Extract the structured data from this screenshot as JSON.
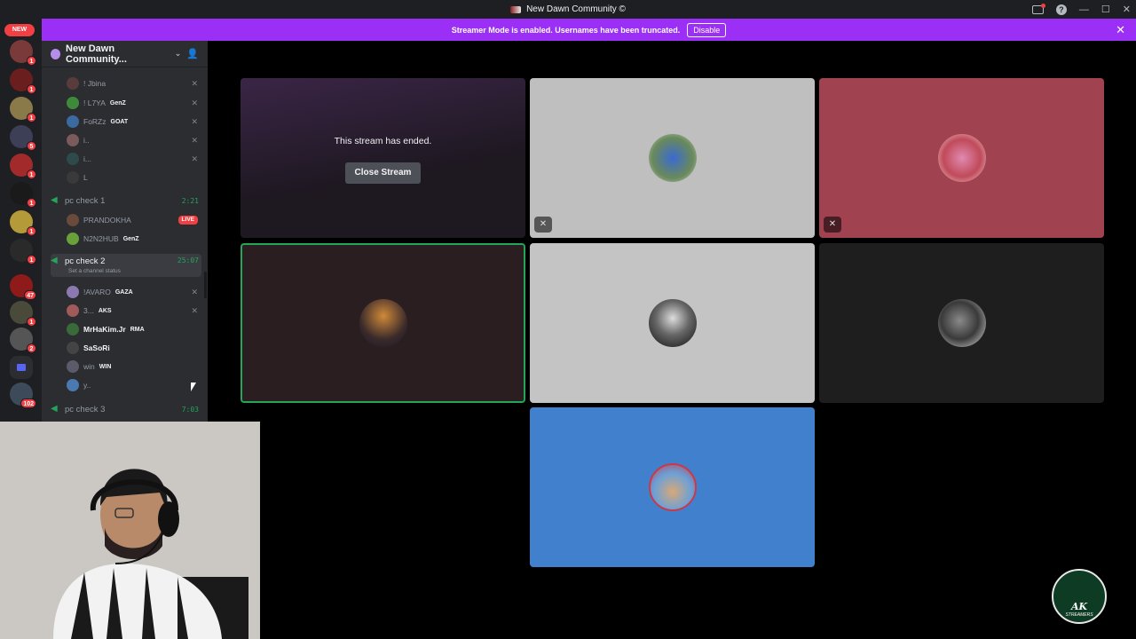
{
  "titlebar": {
    "title": "New Dawn Community ©",
    "icons": [
      "screen-share-icon",
      "help-icon",
      "minimize-icon",
      "maximize-icon",
      "close-icon"
    ]
  },
  "banner": {
    "text": "Streamer Mode is enabled. Usernames have been truncated.",
    "button": "Disable",
    "color": "#9b2ff5"
  },
  "rail": {
    "new_label": "NEW",
    "servers": [
      {
        "badge": "1"
      },
      {
        "badge": "1"
      },
      {
        "badge": "1"
      },
      {
        "badge": "5"
      },
      {
        "badge": "1"
      },
      {
        "badge": "1"
      },
      {
        "badge": "1"
      },
      {
        "badge": "1"
      },
      {
        "badge": "47"
      },
      {
        "badge": "1"
      },
      {
        "badge": "2"
      },
      {
        "badge": ""
      },
      {
        "badge": "102"
      }
    ]
  },
  "sidebar": {
    "server_name": "New Dawn Community...",
    "users_top": [
      {
        "name": "! Jbina",
        "tag": ""
      },
      {
        "name": "! L7YA",
        "tag": "GenZ"
      },
      {
        "name": "FoRZz",
        "tag": "GOAT"
      },
      {
        "name": "i..",
        "tag": ""
      },
      {
        "name": "i...",
        "tag": ""
      },
      {
        "name": "L",
        "tag": ""
      }
    ],
    "channel1": {
      "name": "pc check 1",
      "timer": "2:21"
    },
    "channel1_users": [
      {
        "name": "PRANDOKHA",
        "tag": "",
        "live": "LIVE"
      },
      {
        "name": "N2N2HUB",
        "tag": "GenZ"
      }
    ],
    "channel2": {
      "name": "pc check 2",
      "timer": "25:07",
      "status": "Set a channel status"
    },
    "channel2_users": [
      {
        "name": "!AVARO",
        "tag": "GAZA"
      },
      {
        "name": "3...",
        "tag": "AKS"
      },
      {
        "name": "MrHaKim.Jr",
        "tag": "RMA"
      },
      {
        "name": "SaSoRi",
        "tag": ""
      },
      {
        "name": "win",
        "tag": "WIN"
      },
      {
        "name": "y..",
        "tag": ""
      }
    ],
    "channel3": {
      "name": "pc check 3",
      "timer": "7:03"
    }
  },
  "stage": {
    "ended_text": "This stream has ended.",
    "close_button": "Close Stream",
    "tile_colors": [
      "#1e1821",
      "#bfbfbf",
      "#a0424f",
      "#2a1e20",
      "#c4c4c4",
      "#1e1e1e",
      "#4180cc"
    ]
  },
  "logo": {
    "main": "AK",
    "sub": "STREAMERS"
  }
}
